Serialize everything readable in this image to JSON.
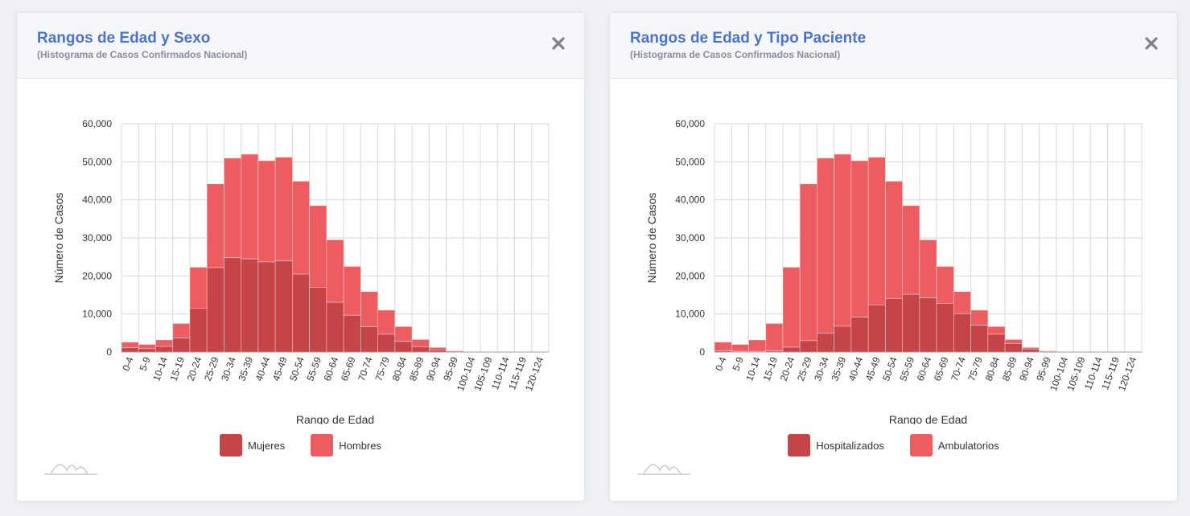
{
  "colors": {
    "dark": "#c44447",
    "light": "#ed5c60",
    "title": "#4a74c9"
  },
  "cards": [
    {
      "title": "Rangos de Edad y Sexo",
      "subtitle": "(Histograma de Casos Confirmados Nacional)",
      "legend": [
        "Mujeres",
        "Hombres"
      ],
      "chart_data": {
        "type": "bar",
        "stacked": true,
        "categories": [
          "0-4",
          "5-9",
          "10-14",
          "15-19",
          "20-24",
          "25-29",
          "30-34",
          "35-39",
          "40-44",
          "45-49",
          "50-54",
          "55-59",
          "60-64",
          "65-69",
          "70-74",
          "75-79",
          "80-84",
          "85-89",
          "90-94",
          "95-99",
          "100-104",
          "105-109",
          "110-114",
          "115-119",
          "120-124"
        ],
        "series": [
          {
            "name": "Mujeres",
            "values": [
              1200,
              900,
              1500,
              3700,
              11500,
              22200,
              24800,
              24500,
              23700,
              24000,
              20500,
              17000,
              13100,
              9700,
              6700,
              4700,
              2800,
              1400,
              500,
              100,
              0,
              0,
              0,
              0,
              0
            ]
          },
          {
            "name": "Hombres",
            "values": [
              1400,
              1100,
              1700,
              3800,
              10800,
              22000,
              26200,
              27500,
              26600,
              27200,
              24400,
              21500,
              16400,
              12800,
              9200,
              6300,
              3900,
              1900,
              700,
              200,
              0,
              0,
              0,
              0,
              0
            ]
          }
        ],
        "xlabel": "Rango de Edad",
        "ylabel": "Número de Casos",
        "ylim": [
          0,
          60000
        ],
        "yticks": [
          "0",
          "10,000",
          "20,000",
          "30,000",
          "40,000",
          "50,000",
          "60,000"
        ],
        "grid": true,
        "legend_position": "bottom"
      }
    },
    {
      "title": "Rangos de Edad y Tipo Paciente",
      "subtitle": "(Histograma de Casos Confirmados Nacional)",
      "legend": [
        "Hospitalizados",
        "Ambulatorios"
      ],
      "chart_data": {
        "type": "bar",
        "stacked": true,
        "categories": [
          "0-4",
          "5-9",
          "10-14",
          "15-19",
          "20-24",
          "25-29",
          "30-34",
          "35-39",
          "40-44",
          "45-49",
          "50-54",
          "55-59",
          "60-64",
          "65-69",
          "70-74",
          "75-79",
          "80-84",
          "85-89",
          "90-94",
          "95-99",
          "100-104",
          "105-109",
          "110-114",
          "115-119",
          "120-124"
        ],
        "series": [
          {
            "name": "Hospitalizados",
            "values": [
              300,
              200,
              200,
              300,
              1300,
              3000,
              5000,
              6800,
              9200,
              12400,
              14100,
              15200,
              14300,
              12800,
              10100,
              7100,
              4700,
              2200,
              800,
              200,
              0,
              0,
              0,
              0,
              0
            ]
          },
          {
            "name": "Ambulatorios",
            "values": [
              2300,
              1800,
              3000,
              7200,
              21000,
              41200,
              46000,
              45200,
              41100,
              38800,
              30800,
              23300,
              15200,
              9700,
              5800,
              3900,
              2000,
              1100,
              400,
              100,
              0,
              0,
              0,
              0,
              0
            ]
          }
        ],
        "xlabel": "Rango de Edad",
        "ylabel": "Número de Casos",
        "ylim": [
          0,
          60000
        ],
        "yticks": [
          "0",
          "10,000",
          "20,000",
          "30,000",
          "40,000",
          "50,000",
          "60,000"
        ],
        "grid": true,
        "legend_position": "bottom"
      }
    }
  ]
}
